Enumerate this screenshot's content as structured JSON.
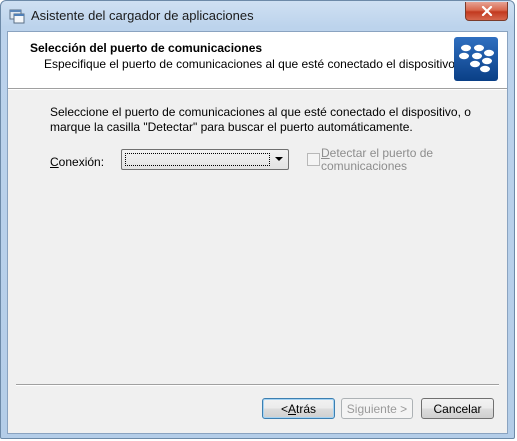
{
  "window": {
    "title": "Asistente del cargador de aplicaciones"
  },
  "header": {
    "title": "Selección del puerto de comunicaciones",
    "subtitle": "Especifique el puerto de comunicaciones al que esté conectado el dispositivo.",
    "logo_icon": "blackberry-logo-icon"
  },
  "body": {
    "instructions_line1": "Seleccione el puerto de comunicaciones al que esté conectado el dispositivo, o",
    "instructions_line2": "marque la casilla \"Detectar\" para buscar el puerto automáticamente.",
    "connection": {
      "label_mnemonic": "C",
      "label_rest": "onexión:",
      "selected_value": ""
    },
    "detect": {
      "label_mnemonic": "D",
      "label_rest_line1": "etectar el puerto de",
      "label_line2": "comunicaciones",
      "checked": false,
      "enabled": false
    }
  },
  "buttons": {
    "back_prefix": "< ",
    "back_mnemonic": "A",
    "back_rest": "trás",
    "next_label": "Siguiente >",
    "cancel_label": "Cancelar"
  },
  "colors": {
    "accent": "#3c7fb1",
    "close_button": "#c2391f",
    "disabled_text": "#8d8d8d"
  }
}
